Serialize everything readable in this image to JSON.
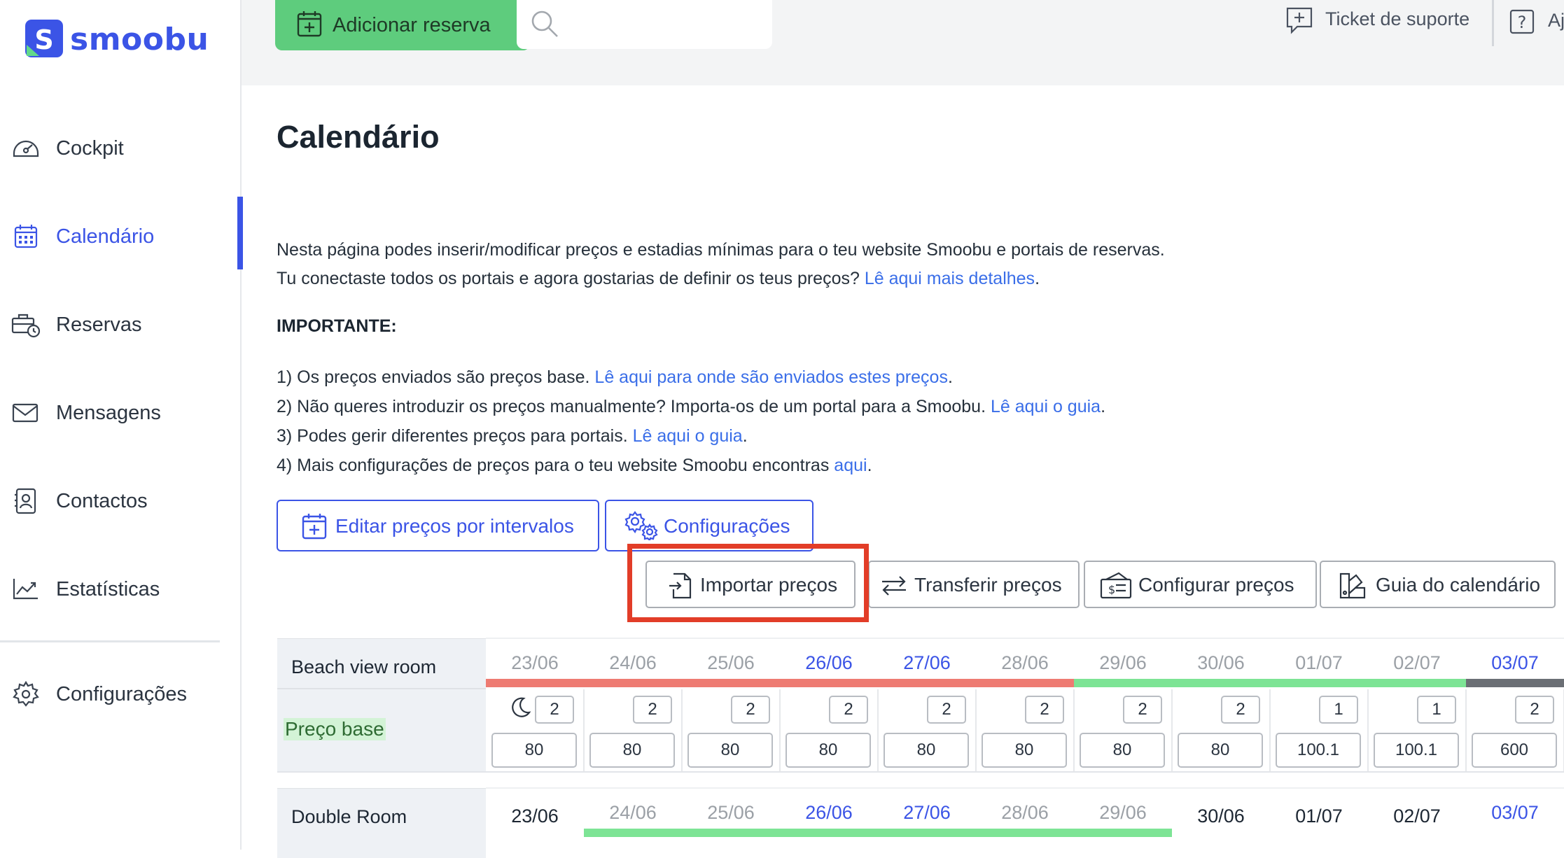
{
  "app": {
    "brand": "smoobu",
    "brand_color": "#3b54e6",
    "accent_green": "#5ecc7d"
  },
  "sidebar": {
    "items": [
      {
        "label": "Cockpit",
        "icon": "gauge-icon"
      },
      {
        "label": "Calendário",
        "icon": "calendar-icon",
        "active": true
      },
      {
        "label": "Reservas",
        "icon": "briefcase-clock-icon"
      },
      {
        "label": "Mensagens",
        "icon": "envelope-icon"
      },
      {
        "label": "Contactos",
        "icon": "contact-card-icon"
      },
      {
        "label": "Estatísticas",
        "icon": "chart-line-icon"
      },
      {
        "label": "Configurações",
        "icon": "gear-icon"
      }
    ]
  },
  "topbar": {
    "add_label": "Adicionar reserva",
    "search_placeholder": "",
    "support_label": "Ticket de suporte",
    "help_label": "Aj"
  },
  "main": {
    "title": "Calendário",
    "intro1": "Nesta página podes inserir/modificar preços e estadias mínimas para o teu website Smoobu e portais de reservas.",
    "intro2_text": "Tu conectaste todos os portais e agora gostarias de definir os teus preços?",
    "intro2_link": "Lê aqui mais detalhes",
    "important": "IMPORTANTE:",
    "notes": [
      {
        "text": "1) Os preços enviados são preços base.",
        "link": "Lê aqui para onde são enviados estes preços",
        "end": "."
      },
      {
        "text": "2) Não queres introduzir os preços manualmente? Importa-os de um portal para a Smoobu.",
        "link": "Lê aqui o guia",
        "end": "."
      },
      {
        "text": "3) Podes gerir diferentes preços para portais.",
        "link": "Lê aqui o guia",
        "end": "."
      },
      {
        "text": "4) Mais configurações de preços para o teu website Smoobu encontras",
        "link": "aqui",
        "end": "."
      }
    ],
    "buttons": {
      "edit_intervals": "Editar preços por intervalos",
      "settings": "Configurações",
      "import": "Importar preços",
      "transfer": "Transferir preços",
      "configure": "Configurar preços",
      "guide": "Guia do calendário"
    }
  },
  "calendar": {
    "rooms": [
      {
        "name": "Beach view room",
        "rate_label": "Preço base",
        "dates": [
          {
            "d": "23/06",
            "style": "gray"
          },
          {
            "d": "24/06",
            "style": "gray"
          },
          {
            "d": "25/06",
            "style": "gray"
          },
          {
            "d": "26/06",
            "style": "blue"
          },
          {
            "d": "27/06",
            "style": "blue"
          },
          {
            "d": "28/06",
            "style": "gray"
          },
          {
            "d": "29/06",
            "style": "gray"
          },
          {
            "d": "30/06",
            "style": "gray"
          },
          {
            "d": "01/07",
            "style": "gray"
          },
          {
            "d": "02/07",
            "style": "gray"
          },
          {
            "d": "03/07",
            "style": "blue"
          }
        ],
        "min_stay": [
          "2",
          "2",
          "2",
          "2",
          "2",
          "2",
          "2",
          "2",
          "1",
          "1",
          "2"
        ],
        "prices": [
          "80",
          "80",
          "80",
          "80",
          "80",
          "80",
          "80",
          "80",
          "100.1",
          "100.1",
          "600"
        ]
      },
      {
        "name": "Double Room",
        "dates": [
          {
            "d": "23/06",
            "style": "dark"
          },
          {
            "d": "24/06",
            "style": "gray"
          },
          {
            "d": "25/06",
            "style": "gray"
          },
          {
            "d": "26/06",
            "style": "blue"
          },
          {
            "d": "27/06",
            "style": "blue"
          },
          {
            "d": "28/06",
            "style": "gray"
          },
          {
            "d": "29/06",
            "style": "gray"
          },
          {
            "d": "30/06",
            "style": "dark"
          },
          {
            "d": "01/07",
            "style": "dark"
          },
          {
            "d": "02/07",
            "style": "dark"
          },
          {
            "d": "03/07",
            "style": "blue"
          }
        ]
      }
    ]
  }
}
